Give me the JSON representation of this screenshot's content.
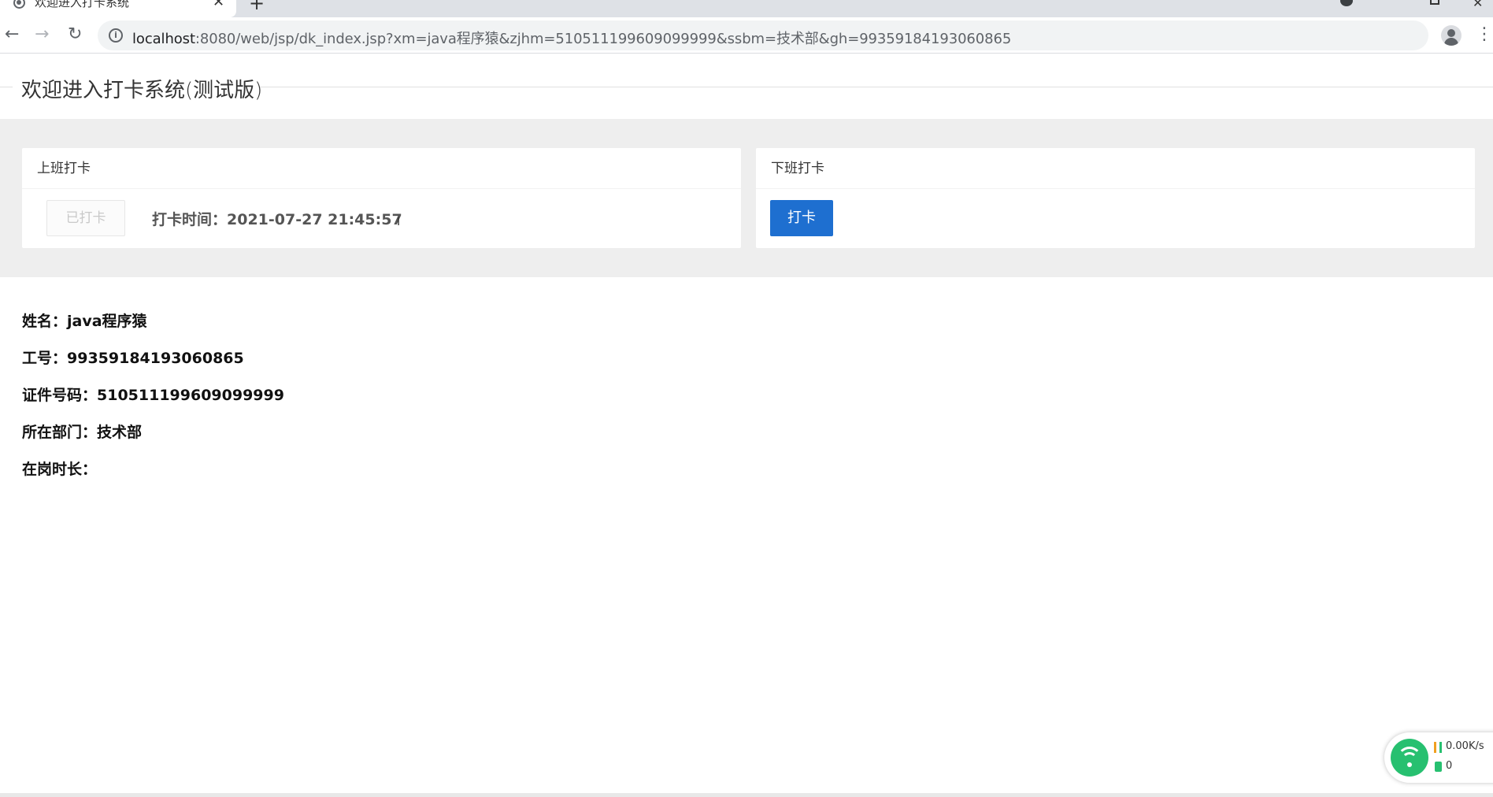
{
  "browser": {
    "tab_title": "欢迎进入打卡系统",
    "tab_close": "✕",
    "new_tab": "+",
    "url_host": "localhost",
    "url_rest": ":8080/web/jsp/dk_index.jsp?xm=java程序猿&zjhm=510511199609099999&ssbm=技术部&gh=99359184193060865",
    "back": "←",
    "forward": "→",
    "reload": "↻",
    "info": "i",
    "star": "☆",
    "menu": "⋮",
    "window_close": "✕"
  },
  "page": {
    "title": "欢迎进入打卡系统(测试版)"
  },
  "clock_in": {
    "header": "上班打卡",
    "button_label": "已打卡",
    "time_text": "打卡时间：2021-07-27 21:45:57",
    "cursor": "I"
  },
  "clock_out": {
    "header": "下班打卡",
    "button_label": "打卡"
  },
  "info": {
    "name": "姓名：java程序猿",
    "employee_id": "工号：99359184193060865",
    "id_number": "证件号码：510511199609099999",
    "department": "所在部门：技术部",
    "duration": "在岗时长："
  },
  "network_widget": {
    "speed": "0.00K/s",
    "count": "0"
  },
  "colors": {
    "primary_button": "#1e6fd0",
    "card_area_bg": "#eeeeee",
    "wifi_green": "#27c070"
  },
  "icons": [
    "tab-favicon-icon",
    "back-arrow-icon",
    "forward-arrow-icon",
    "reload-icon",
    "info-icon",
    "star-icon",
    "profile-icon",
    "menu-icon",
    "wifi-icon",
    "speed-icon",
    "phone-icon",
    "text-cursor-icon"
  ]
}
